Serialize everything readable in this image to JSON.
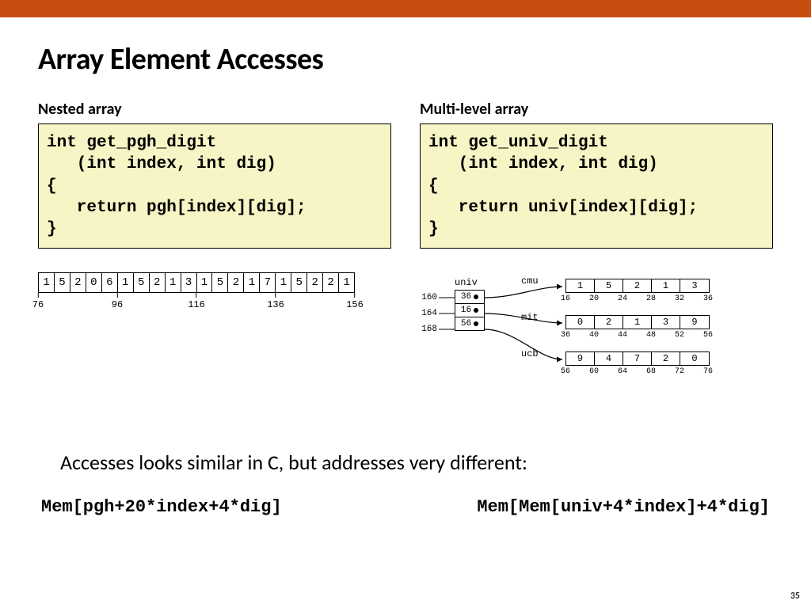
{
  "title": "Array Element Accesses",
  "left": {
    "heading": "Nested array",
    "code": "int get_pgh_digit\n   (int index, int dig)\n{\n   return pgh[index][dig];\n}",
    "cells": [
      "1",
      "5",
      "2",
      "0",
      "6",
      "1",
      "5",
      "2",
      "1",
      "3",
      "1",
      "5",
      "2",
      "1",
      "7",
      "1",
      "5",
      "2",
      "2",
      "1"
    ],
    "ticks": [
      "76",
      "96",
      "116",
      "136",
      "156"
    ]
  },
  "right": {
    "heading": "Multi-level array",
    "code": "int get_univ_digit\n   (int index, int dig)\n{\n   return univ[index][dig];\n}",
    "univ_label": "univ",
    "ptr_addrs": [
      "160",
      "164",
      "168"
    ],
    "ptr_vals": [
      "36",
      "16",
      "56"
    ],
    "rows": [
      {
        "name": "cmu",
        "vals": [
          "1",
          "5",
          "2",
          "1",
          "3"
        ],
        "ticks": [
          "16",
          "20",
          "24",
          "28",
          "32",
          "36"
        ]
      },
      {
        "name": "mit",
        "vals": [
          "0",
          "2",
          "1",
          "3",
          "9"
        ],
        "ticks": [
          "36",
          "40",
          "44",
          "48",
          "52",
          "56"
        ]
      },
      {
        "name": "ucb",
        "vals": [
          "9",
          "4",
          "7",
          "2",
          "0"
        ],
        "ticks": [
          "56",
          "60",
          "64",
          "68",
          "72",
          "76"
        ]
      }
    ]
  },
  "note": "Accesses looks similar in C, but addresses very different:",
  "mem_left": "Mem[pgh+20*index+4*dig]",
  "mem_right": "Mem[Mem[univ+4*index]+4*dig]",
  "page": "35"
}
